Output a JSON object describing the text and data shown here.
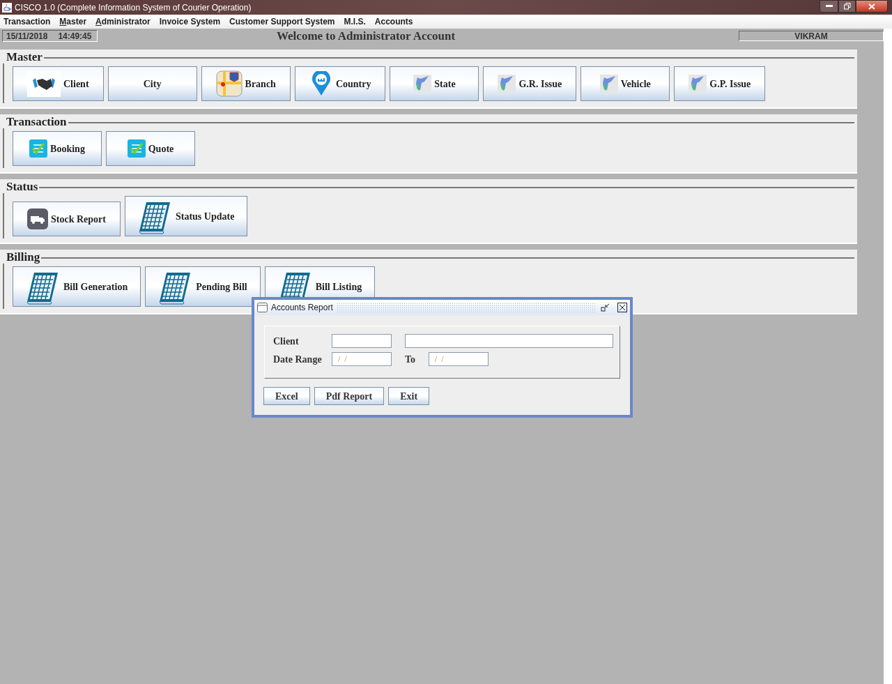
{
  "window": {
    "title": "CISCO 1.0 (Complete Information System of Courier Operation)"
  },
  "menu": [
    {
      "label": "Transaction",
      "mnemonic": false
    },
    {
      "label": "Master",
      "mnemonic": true
    },
    {
      "label": "Administrator",
      "mnemonic": true
    },
    {
      "label": "Invoice System",
      "mnemonic": false
    },
    {
      "label": "Customer Support System",
      "mnemonic": false
    },
    {
      "label": "M.I.S.",
      "mnemonic": false
    },
    {
      "label": "Accounts",
      "mnemonic": false
    }
  ],
  "status_bar": {
    "date": "15/11/2018",
    "time": "14:49:45",
    "welcome": "Welcome to Administrator Account",
    "user": "VIKRAM"
  },
  "sections": [
    {
      "title": "Master",
      "buttons": [
        {
          "label": "Client",
          "kind": "handshake"
        },
        {
          "label": "City",
          "kind": "plain"
        },
        {
          "label": "Branch",
          "kind": "map"
        },
        {
          "label": "Country",
          "kind": "pin"
        },
        {
          "label": "State",
          "kind": "region"
        },
        {
          "label": "G.R. Issue",
          "kind": "region"
        },
        {
          "label": "Vehicle",
          "kind": "region"
        },
        {
          "label": "G.P. Issue",
          "kind": "region"
        }
      ]
    },
    {
      "title": "Transaction",
      "buttons": [
        {
          "label": "Booking",
          "kind": "checklist"
        },
        {
          "label": "Quote",
          "kind": "checklist"
        }
      ]
    },
    {
      "title": "Status",
      "buttons": [
        {
          "label": "Stock Report",
          "kind": "truck"
        },
        {
          "label": "Status Update",
          "kind": "calendar"
        }
      ]
    },
    {
      "title": "Billing",
      "buttons": [
        {
          "label": "Bill Generation",
          "kind": "calendar"
        },
        {
          "label": "Pending Bill",
          "kind": "calendar"
        },
        {
          "label": "Bill Listing",
          "kind": "calendar"
        }
      ]
    }
  ],
  "dialog": {
    "title": "Accounts Report",
    "client_label": "Client",
    "date_label": "Date Range",
    "to_label": "To",
    "date_from": "/  /",
    "date_to": "/  /",
    "buttons": [
      "Excel",
      "Pdf Report",
      "Exit"
    ]
  }
}
